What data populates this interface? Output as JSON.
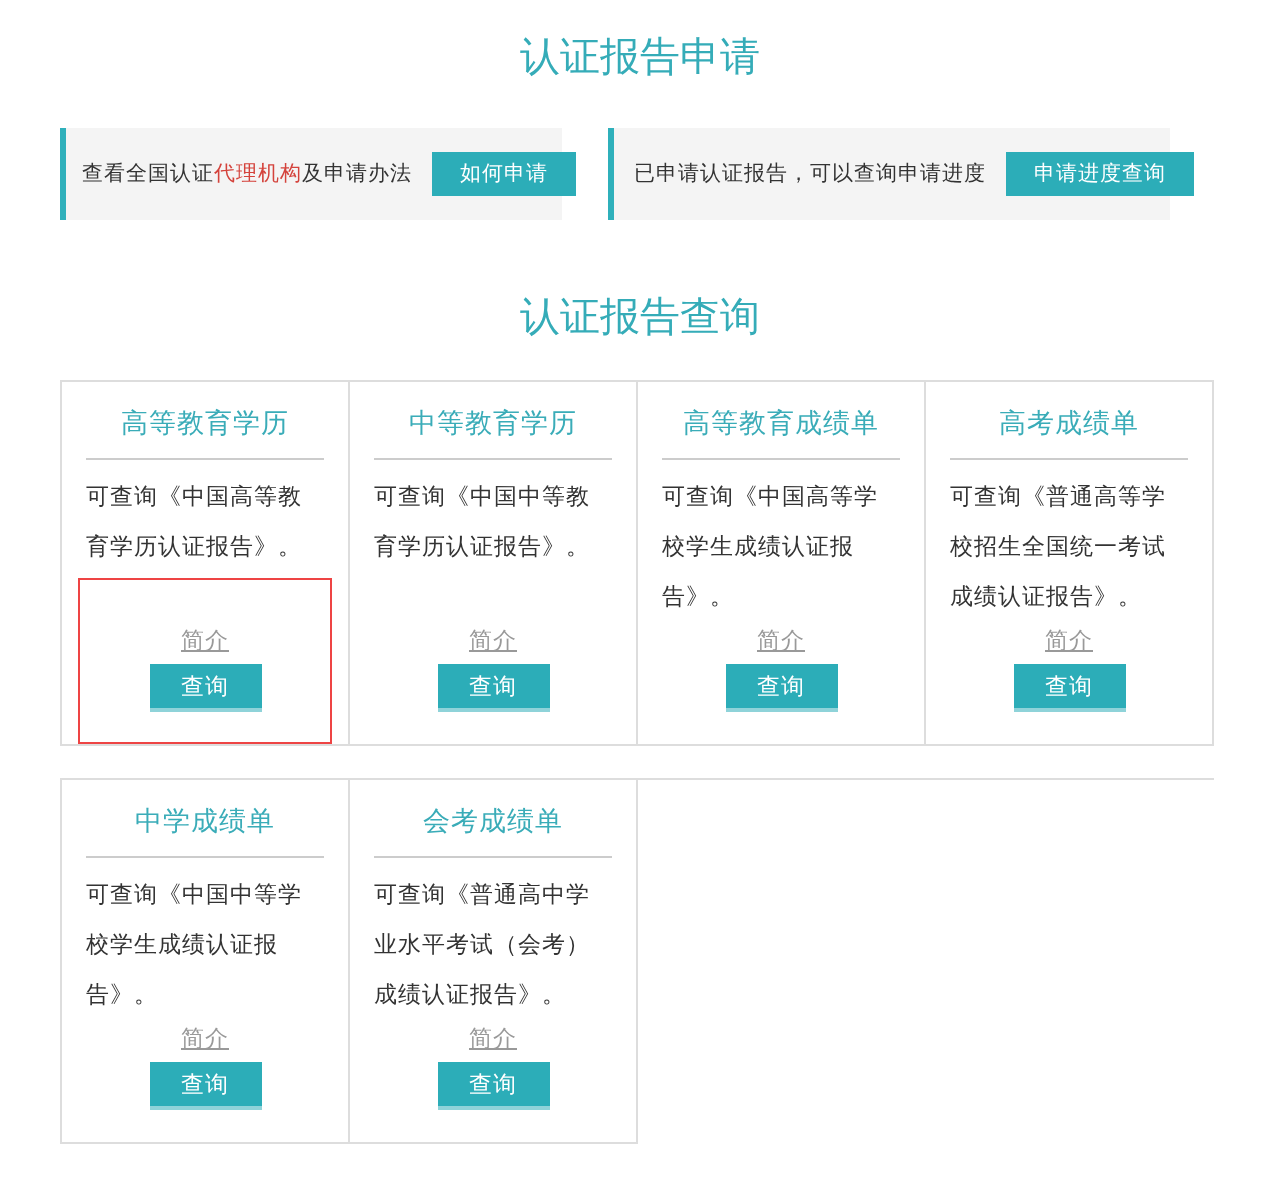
{
  "apply_section": {
    "title": "认证报告申请",
    "panels": [
      {
        "parts": [
          {
            "kind": "plain",
            "text": "查看全国认证"
          },
          {
            "kind": "link",
            "text": "代理机构"
          },
          {
            "kind": "plain",
            "text": "及申请办法"
          }
        ],
        "button": "如何申请"
      },
      {
        "parts": [
          {
            "kind": "plain",
            "text": "已申请认证报告，可以查询申请进度"
          }
        ],
        "button": "申请进度查询"
      }
    ]
  },
  "query_section": {
    "title": "认证报告查询",
    "cards": [
      {
        "title": "高等教育学历",
        "description": "可查询《中国高等教育学历认证报告》。",
        "intro_link": "简介",
        "button": "查询",
        "highlighted": true
      },
      {
        "title": "中等教育学历",
        "description": "可查询《中国中等教育学历认证报告》。",
        "intro_link": "简介",
        "button": "查询",
        "highlighted": false
      },
      {
        "title": "高等教育成绩单",
        "description": "可查询《中国高等学校学生成绩认证报告》。",
        "intro_link": "简介",
        "button": "查询",
        "highlighted": false
      },
      {
        "title": "高考成绩单",
        "description": "可查询《普通高等学校招生全国统一考试成绩认证报告》。",
        "intro_link": "简介",
        "button": "查询",
        "highlighted": false
      },
      {
        "title": "中学成绩单",
        "description": "可查询《中国中等学校学生成绩认证报告》。",
        "intro_link": "简介",
        "button": "查询",
        "highlighted": false
      },
      {
        "title": "会考成绩单",
        "description": "可查询《普通高中学业水平考试（会考）成绩认证报告》。",
        "intro_link": "简介",
        "button": "查询",
        "highlighted": false
      }
    ]
  }
}
